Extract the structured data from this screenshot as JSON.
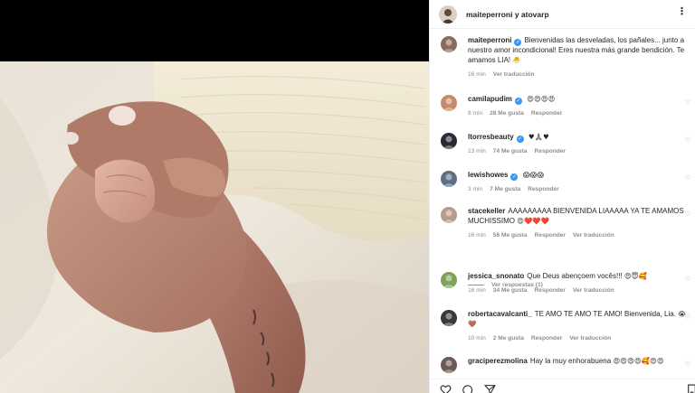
{
  "post": {
    "header_title": "maiteperroni y atovarp",
    "more_icon": "more-horizontal-icon"
  },
  "comments": [
    {
      "username": "maiteperroni",
      "verified": true,
      "text": "Bienvenidas las desveladas, los pañales... junto a nuestro amor incondicional! Eres nuestra más grande bendición. Te amamos LIA!",
      "emoji": "🐣",
      "time": "16 min",
      "likes": "",
      "reply": "",
      "translate": "Ver traducción",
      "avatar_color": "#8a6a58"
    },
    {
      "username": "camilapudim",
      "verified": true,
      "text": "",
      "emoji": "😍😍😍😍",
      "time": "8 min",
      "likes": "28 Me gusta",
      "reply": "Responder",
      "translate": "",
      "avatar_color": "#c48a6a"
    },
    {
      "username": "ltorresbeauty",
      "verified": true,
      "text": "",
      "emoji": "♥🙏🏽♥",
      "time": "13 min",
      "likes": "74 Me gusta",
      "reply": "Responder",
      "translate": "",
      "avatar_color": "#2a2a35"
    },
    {
      "username": "lewishowes",
      "verified": true,
      "text": "",
      "emoji": "😱😱😱",
      "time": "3 min",
      "likes": "7 Me gusta",
      "reply": "Responder",
      "translate": "",
      "avatar_color": "#5c6f86"
    },
    {
      "username": "stacekeller",
      "verified": false,
      "text": "AAAAAAAAA BIENVENIDA LIAAAAA YA TE AMAMOS MUCHISSIMO",
      "emoji": "😍❤️❤️❤️",
      "time": "16 min",
      "likes": "56 Me gusta",
      "reply": "Responder",
      "translate": "Ver traducción",
      "avatar_color": "#b89a8a"
    },
    {
      "username": "jessica_snonato",
      "verified": false,
      "text": "Que Deus abençoem vocês!!!",
      "emoji": "😍😇🥰",
      "time": "16 min",
      "likes": "34 Me gusta",
      "reply": "Responder",
      "translate": "Ver traducción",
      "avatar_color": "#7ea35a"
    },
    {
      "username": "robertacavalcanti_",
      "verified": false,
      "text": "TE AMO TE AMO TE AMO! Bienvenida, Lia.",
      "emoji": "😭🤎",
      "time": "10 min",
      "likes": "2 Me gusta",
      "reply": "Responder",
      "translate": "Ver traducción",
      "avatar_color": "#3a3a3a"
    },
    {
      "username": "graciperezmolina",
      "verified": false,
      "text": "Hay la muy enhorabuena",
      "emoji": "😍😍😍😍🥰😍😍",
      "time": "",
      "likes": "",
      "reply": "",
      "translate": "",
      "avatar_color": "#6d5a52"
    }
  ],
  "view_replies": "Ver respuestas (1)",
  "icons": {
    "like": "heart-icon",
    "comment": "comment-icon",
    "share": "share-icon",
    "save": "bookmark-icon"
  }
}
